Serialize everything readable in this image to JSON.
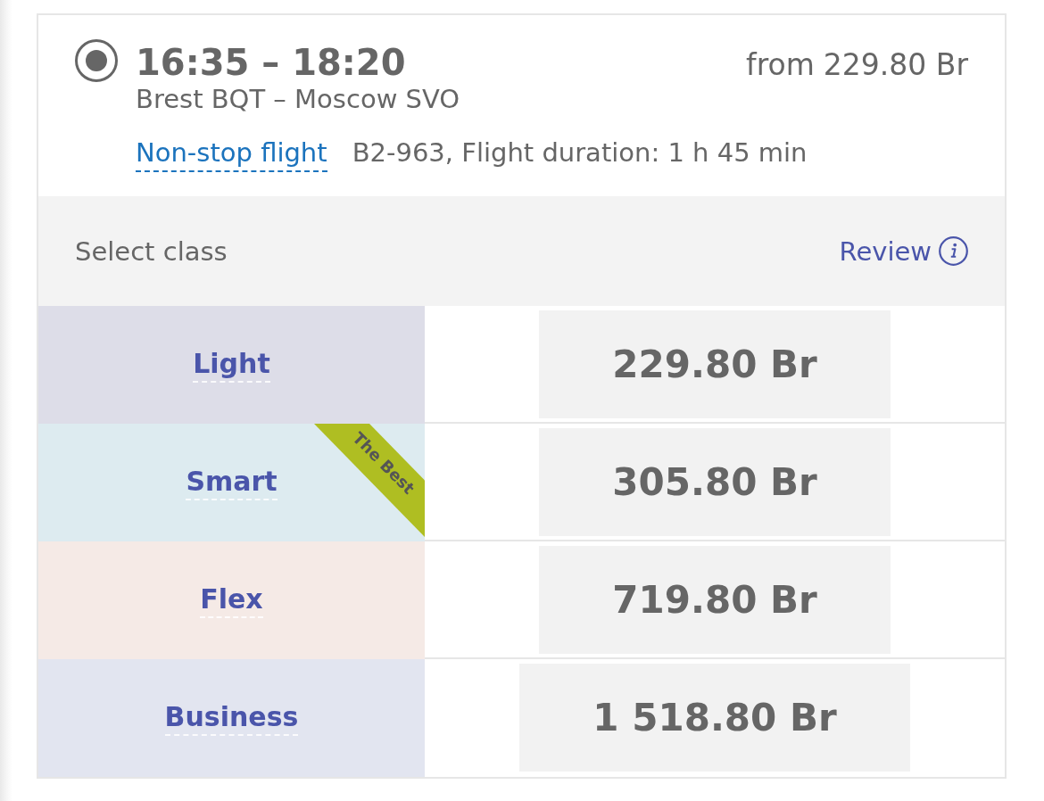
{
  "flight": {
    "selected": true,
    "times": "16:35 – 18:20",
    "route": "Brest BQT – Moscow SVO",
    "stops_link": "Non-stop flight",
    "details": "B2-963, Flight duration: 1 h 45 min",
    "price_prefix": "from",
    "price": "229.80 Br"
  },
  "class_header": {
    "label": "Select class",
    "review_link": "Review"
  },
  "classes": [
    {
      "name": "Light",
      "color": "#dddde8",
      "price": "229.80 Br"
    },
    {
      "name": "Smart",
      "color": "#ddebf0",
      "price": "305.80 Br",
      "ribbon": "The Best"
    },
    {
      "name": "Flex",
      "color": "#f5eae6",
      "price": "719.80 Br"
    },
    {
      "name": "Business",
      "color": "#e2e5f0",
      "price": "1 518.80 Br"
    }
  ]
}
